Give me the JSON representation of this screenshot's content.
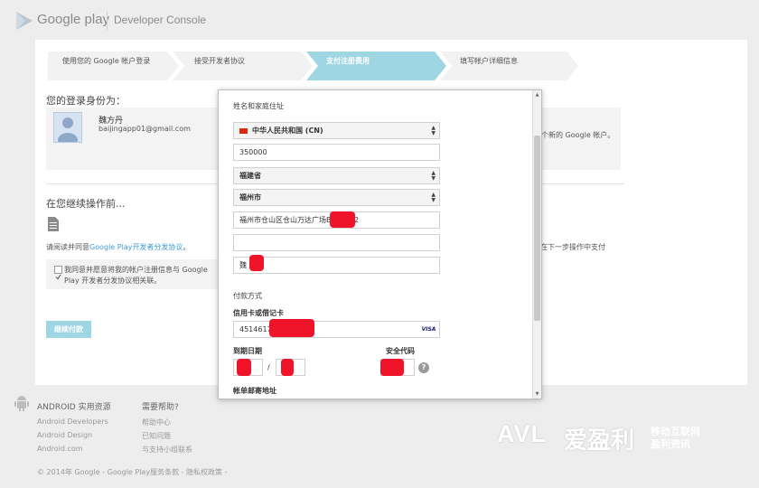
{
  "header": {
    "product_name": "Google play",
    "console_name": "Developer Console"
  },
  "steps": [
    {
      "label": "使用您的 Google 帐户登录"
    },
    {
      "label": "接受开发者协议"
    },
    {
      "label": "支付注册费用"
    },
    {
      "label": "填写帐户详细信息"
    }
  ],
  "identity": {
    "title": "您的登录身份为：",
    "name": "魏方丹",
    "email": "baijingapp01@gmail.com",
    "note": "个新的 Google 帐户。"
  },
  "continue_section": {
    "title": "在您继续操作前...",
    "read_prefix": "请阅读并同意",
    "read_link": "Google Play开发者分发协议",
    "read_suffix": "。",
    "pay_note": "在下一步操作中支付",
    "agree_text": "我同意并愿意将我的帐户注册信息与 Google Play 开发者分发协议相关联。",
    "continue_button": "继续付款"
  },
  "dialog": {
    "name_address_title": "姓名和家庭住址",
    "country": "中华人民共和国 (CN)",
    "postal_code": "350000",
    "province": "福建省",
    "city": "福州市",
    "address_line1": "福州市仓山区仓山万达广场B",
    "address_line1_tail": "2",
    "address_line2": "",
    "name_value": "魏",
    "payment_title": "付款方式",
    "card_label": "信用卡或借记卡",
    "card_number": "45146176",
    "card_brand": "VISA",
    "expiry_label": "到期日期",
    "expiry_sep": "/",
    "cvc_label": "安全代码",
    "help_glyph": "?",
    "billing_label": "帐单邮寄地址"
  },
  "footer": {
    "android_title": "ANDROID 实用资源",
    "android_links": [
      "Android Developers",
      "Android Design",
      "Android.com"
    ],
    "help_title": "需要帮助?",
    "help_links": [
      "帮助中心",
      "已知问题",
      "与支持小组联系"
    ],
    "copyright": "© 2014年 Google - Google Play服务条款 - 隐私权政策 -"
  },
  "watermark": {
    "latin": "AVL",
    "chinese": "爱盈利",
    "sub_line1": "移动互联网",
    "sub_line2": "盈利资讯"
  },
  "colors": {
    "accent": "#9fd6e3",
    "link": "#3d9bd3",
    "redaction": "#f0142a"
  }
}
